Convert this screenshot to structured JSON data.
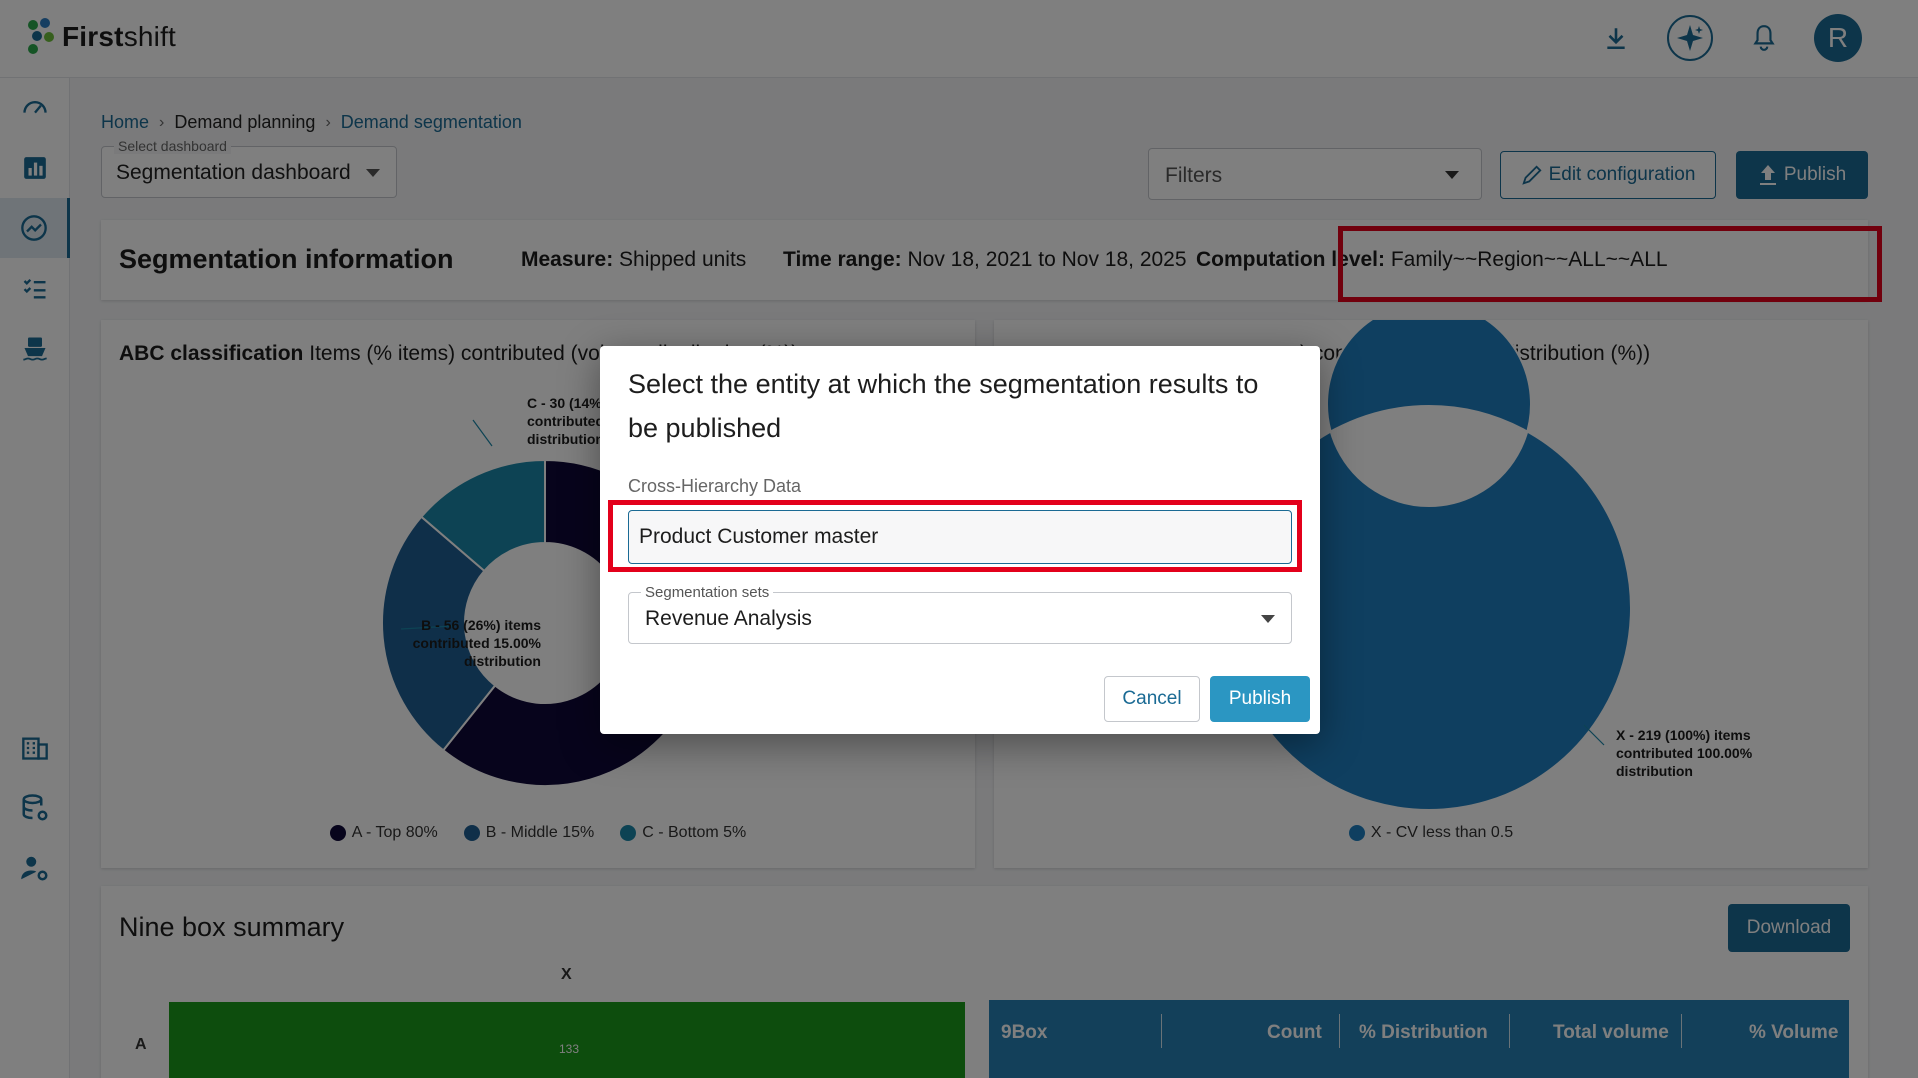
{
  "app": {
    "logo_text_bold": "First",
    "logo_text_light": "shift",
    "avatar_initial": "R"
  },
  "colors": {
    "brand": "#1a6a94",
    "seg_a": "#0e0838",
    "seg_b": "#1f5f93",
    "seg_c": "#1a87a8",
    "seg_x": "#1f7fc0",
    "highlight": "#e3001b",
    "ninebox_green": "#1b9a1b"
  },
  "top_icons": [
    "download-icon",
    "sparkle-icon",
    "bell-icon"
  ],
  "sidebar": {
    "items": [
      "speedometer-icon",
      "bar-chart-icon",
      "trend-icon",
      "checklist-icon",
      "ship-icon",
      "building-icon",
      "database-gear-icon",
      "user-gear-icon"
    ]
  },
  "breadcrumb": {
    "home": "Home",
    "sep": "›",
    "demand_planning": "Demand planning",
    "current": "Demand segmentation"
  },
  "dashboard_select": {
    "label": "Select dashboard",
    "value": "Segmentation dashboard"
  },
  "filters": {
    "placeholder": "Filters"
  },
  "toolbar": {
    "edit_label": "Edit configuration",
    "publish_label": "Publish"
  },
  "seg_info": {
    "title": "Segmentation information",
    "measure_label": "Measure:",
    "measure_value": "Shipped units",
    "time_label": "Time range:",
    "time_value": "Nov 18, 2021 to Nov 18, 2025",
    "comp_label": "Computation level:",
    "comp_value": "Family~~Region~~ALL~~ALL"
  },
  "abc_chart": {
    "title_bold": "ABC classification",
    "title_rest": "Items (% items) contributed (volume distribution (%))",
    "legend": [
      "A - Top 80%",
      "B - Middle 15%",
      "C - Bottom 5%"
    ],
    "label_b": "B - 56 (26%) items contributed 15.00% distribution",
    "label_c": "C - 30 (14%) items contributed distribution"
  },
  "xyz_chart": {
    "title_rest": "ms) contributed (volume distribution (%))",
    "legend": [
      "X - CV less than 0.5"
    ],
    "label_x": "X - 219 (100%) items contributed 100.00% distribution"
  },
  "chart_data": [
    {
      "type": "pie",
      "title": "ABC classification",
      "categories": [
        "A - Top 80%",
        "B - Middle 15%",
        "C - Bottom 5%"
      ],
      "values": [
        133,
        56,
        30
      ],
      "percent_items": [
        60,
        26,
        14
      ]
    },
    {
      "type": "pie",
      "categories": [
        "X - CV less than 0.5"
      ],
      "values": [
        219
      ],
      "percent_items": [
        100
      ]
    }
  ],
  "nine_box": {
    "title": "Nine box summary",
    "download_label": "Download",
    "x_label": "X",
    "row_label": "A",
    "cell_value": "133",
    "columns": [
      "9Box",
      "Count",
      "% Distribution",
      "Total volume",
      "% Volume"
    ]
  },
  "dialog": {
    "title": "Select the entity at which the segmentation results to be published",
    "field_label": "Cross-Hierarchy Data",
    "field_value": "Product Customer master",
    "select_label": "Segmentation sets",
    "select_value": "Revenue Analysis",
    "cancel_label": "Cancel",
    "publish_label": "Publish"
  }
}
